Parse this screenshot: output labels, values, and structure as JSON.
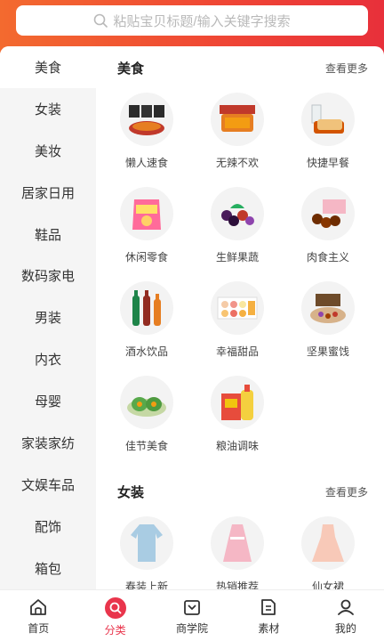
{
  "search": {
    "placeholder": "粘贴宝贝标题/输入关键字搜索"
  },
  "sidebar": {
    "items": [
      {
        "label": "美食"
      },
      {
        "label": "女装"
      },
      {
        "label": "美妆"
      },
      {
        "label": "居家日用"
      },
      {
        "label": "鞋品"
      },
      {
        "label": "数码家电"
      },
      {
        "label": "男装"
      },
      {
        "label": "内衣"
      },
      {
        "label": "母婴"
      },
      {
        "label": "家装家纺"
      },
      {
        "label": "文娱车品"
      },
      {
        "label": "配饰"
      },
      {
        "label": "箱包"
      }
    ]
  },
  "sections": [
    {
      "title": "美食",
      "more": "查看更多",
      "items": [
        {
          "label": "懒人速食"
        },
        {
          "label": "无辣不欢"
        },
        {
          "label": "快捷早餐"
        },
        {
          "label": "休闲零食"
        },
        {
          "label": "生鲜果蔬"
        },
        {
          "label": "肉食主义"
        },
        {
          "label": "酒水饮品"
        },
        {
          "label": "幸福甜品"
        },
        {
          "label": "坚果蜜饯"
        },
        {
          "label": "佳节美食"
        },
        {
          "label": "粮油调味"
        }
      ]
    },
    {
      "title": "女装",
      "more": "查看更多",
      "items": [
        {
          "label": "春装上新"
        },
        {
          "label": "热销推荐"
        },
        {
          "label": "仙女裙"
        }
      ]
    }
  ],
  "tabbar": {
    "items": [
      {
        "label": "首页",
        "icon": "home-icon"
      },
      {
        "label": "分类",
        "icon": "search-icon"
      },
      {
        "label": "商学院",
        "icon": "academy-icon"
      },
      {
        "label": "素材",
        "icon": "material-icon"
      },
      {
        "label": "我的",
        "icon": "profile-icon"
      }
    ]
  },
  "colors": {
    "accent": "#e9354c",
    "header_start": "#f36a2f",
    "header_end": "#e8303a"
  }
}
